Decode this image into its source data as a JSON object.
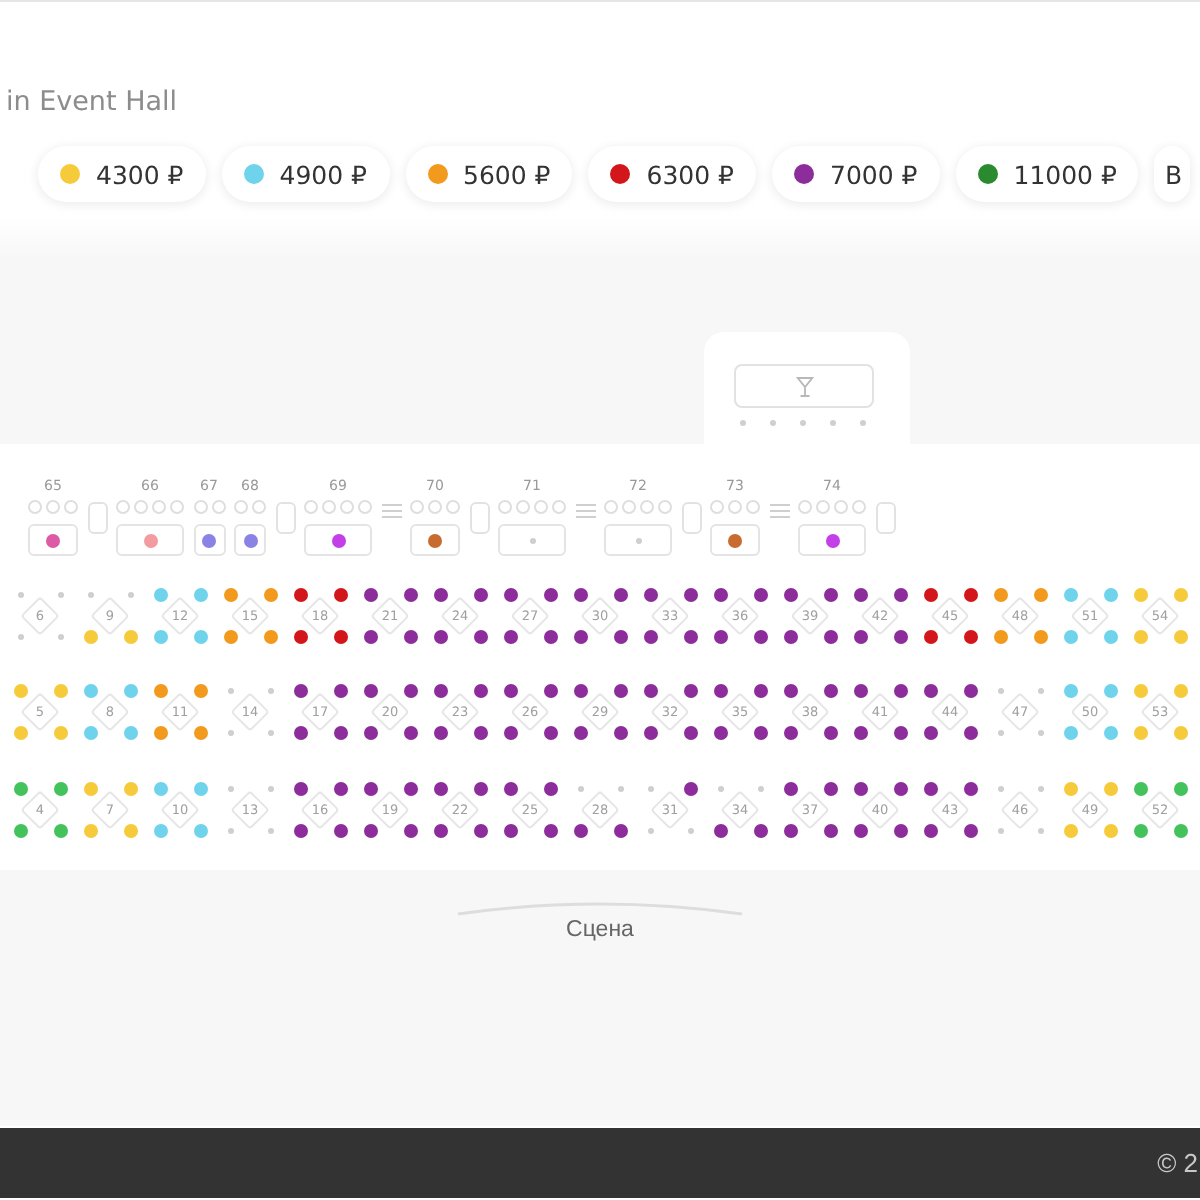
{
  "venue_title": "in Event Hall",
  "price_filters": [
    {
      "kind": "price",
      "label": "4300 ₽",
      "color": "#f6cb3b"
    },
    {
      "kind": "price",
      "label": "4900 ₽",
      "color": "#6fd3ec"
    },
    {
      "kind": "price",
      "label": "5600 ₽",
      "color": "#f29a1e"
    },
    {
      "kind": "price",
      "label": "6300 ₽",
      "color": "#d2161c"
    },
    {
      "kind": "price",
      "label": "7000 ₽",
      "color": "#8d2d9b"
    },
    {
      "kind": "price",
      "label": "11000 ₽",
      "color": "#2a8a30"
    },
    {
      "kind": "plain",
      "label": "В"
    }
  ],
  "bar": {
    "seats": [
      {
        "available": false
      },
      {
        "available": false
      },
      {
        "available": false
      },
      {
        "available": false
      },
      {
        "available": false
      }
    ]
  },
  "loges": [
    {
      "kind": "loge",
      "number": "65",
      "chairs": [
        {
          "available": false
        },
        {
          "available": false
        },
        {
          "available": false
        }
      ],
      "table": {
        "available": true,
        "color": "#dc5aa6"
      }
    },
    {
      "kind": "pillar"
    },
    {
      "kind": "loge",
      "number": "66",
      "chairs": [
        {
          "available": false
        },
        {
          "available": false
        },
        {
          "available": false
        },
        {
          "available": false
        }
      ],
      "table": {
        "available": true,
        "color": "#f29ba0"
      }
    },
    {
      "kind": "loge",
      "number": "67",
      "chairs": [
        {
          "available": false
        },
        {
          "available": false
        }
      ],
      "table": {
        "available": true,
        "color": "#8b82e6"
      }
    },
    {
      "kind": "loge",
      "number": "68",
      "chairs": [
        {
          "available": false
        },
        {
          "available": false
        }
      ],
      "table": {
        "available": true,
        "color": "#8b82e6"
      }
    },
    {
      "kind": "pillar"
    },
    {
      "kind": "loge",
      "number": "69",
      "chairs": [
        {
          "available": false
        },
        {
          "available": false
        },
        {
          "available": false
        },
        {
          "available": false
        }
      ],
      "table": {
        "available": true,
        "color": "#c340e8"
      }
    },
    {
      "kind": "stripes"
    },
    {
      "kind": "loge",
      "number": "70",
      "chairs": [
        {
          "available": false
        },
        {
          "available": false
        },
        {
          "available": false
        }
      ],
      "table": {
        "available": true,
        "color": "#c76b2f"
      }
    },
    {
      "kind": "pillar"
    },
    {
      "kind": "loge",
      "number": "71",
      "chairs": [
        {
          "available": false
        },
        {
          "available": false
        },
        {
          "available": false
        },
        {
          "available": false
        }
      ],
      "table": {
        "available": false
      }
    },
    {
      "kind": "stripes"
    },
    {
      "kind": "loge",
      "number": "72",
      "chairs": [
        {
          "available": false
        },
        {
          "available": false
        },
        {
          "available": false
        },
        {
          "available": false
        }
      ],
      "table": {
        "available": false
      }
    },
    {
      "kind": "pillar"
    },
    {
      "kind": "loge",
      "number": "73",
      "chairs": [
        {
          "available": false
        },
        {
          "available": false
        },
        {
          "available": false
        }
      ],
      "table": {
        "available": true,
        "color": "#c76b2f"
      }
    },
    {
      "kind": "stripes"
    },
    {
      "kind": "loge",
      "number": "74",
      "chairs": [
        {
          "available": false
        },
        {
          "available": false
        },
        {
          "available": false
        },
        {
          "available": false
        }
      ],
      "table": {
        "available": true,
        "color": "#c340e8"
      }
    },
    {
      "kind": "pillar"
    }
  ],
  "rows": [
    {
      "tables": [
        {
          "number": "6",
          "seats": [
            {
              "available": false
            },
            {
              "available": false
            },
            {
              "available": false
            },
            {
              "available": false
            }
          ]
        },
        {
          "number": "9",
          "seats": [
            {
              "available": false
            },
            {
              "available": false
            },
            {
              "available": true,
              "color": "#f6cb3b"
            },
            {
              "available": true,
              "color": "#f6cb3b"
            }
          ]
        },
        {
          "number": "12",
          "seats": [
            {
              "available": true,
              "color": "#6fd3ec"
            },
            {
              "available": true,
              "color": "#6fd3ec"
            },
            {
              "available": true,
              "color": "#6fd3ec"
            },
            {
              "available": true,
              "color": "#6fd3ec"
            }
          ]
        },
        {
          "number": "15",
          "seats": [
            {
              "available": true,
              "color": "#f29a1e"
            },
            {
              "available": true,
              "color": "#f29a1e"
            },
            {
              "available": true,
              "color": "#f29a1e"
            },
            {
              "available": true,
              "color": "#f29a1e"
            }
          ]
        },
        {
          "number": "18",
          "seats": [
            {
              "available": true,
              "color": "#d2161c"
            },
            {
              "available": true,
              "color": "#d2161c"
            },
            {
              "available": true,
              "color": "#d2161c"
            },
            {
              "available": true,
              "color": "#d2161c"
            }
          ]
        },
        {
          "number": "21",
          "seats": [
            {
              "available": true,
              "color": "#8d2d9b"
            },
            {
              "available": true,
              "color": "#8d2d9b"
            },
            {
              "available": true,
              "color": "#8d2d9b"
            },
            {
              "available": true,
              "color": "#8d2d9b"
            }
          ]
        },
        {
          "number": "24",
          "seats": [
            {
              "available": true,
              "color": "#8d2d9b"
            },
            {
              "available": true,
              "color": "#8d2d9b"
            },
            {
              "available": true,
              "color": "#8d2d9b"
            },
            {
              "available": true,
              "color": "#8d2d9b"
            }
          ]
        },
        {
          "number": "27",
          "seats": [
            {
              "available": true,
              "color": "#8d2d9b"
            },
            {
              "available": true,
              "color": "#8d2d9b"
            },
            {
              "available": true,
              "color": "#8d2d9b"
            },
            {
              "available": true,
              "color": "#8d2d9b"
            }
          ]
        },
        {
          "number": "30",
          "seats": [
            {
              "available": true,
              "color": "#8d2d9b"
            },
            {
              "available": true,
              "color": "#8d2d9b"
            },
            {
              "available": true,
              "color": "#8d2d9b"
            },
            {
              "available": true,
              "color": "#8d2d9b"
            }
          ]
        },
        {
          "number": "33",
          "seats": [
            {
              "available": true,
              "color": "#8d2d9b"
            },
            {
              "available": true,
              "color": "#8d2d9b"
            },
            {
              "available": true,
              "color": "#8d2d9b"
            },
            {
              "available": true,
              "color": "#8d2d9b"
            }
          ]
        },
        {
          "number": "36",
          "seats": [
            {
              "available": true,
              "color": "#8d2d9b"
            },
            {
              "available": true,
              "color": "#8d2d9b"
            },
            {
              "available": true,
              "color": "#8d2d9b"
            },
            {
              "available": true,
              "color": "#8d2d9b"
            }
          ]
        },
        {
          "number": "39",
          "seats": [
            {
              "available": true,
              "color": "#8d2d9b"
            },
            {
              "available": true,
              "color": "#8d2d9b"
            },
            {
              "available": true,
              "color": "#8d2d9b"
            },
            {
              "available": true,
              "color": "#8d2d9b"
            }
          ]
        },
        {
          "number": "42",
          "seats": [
            {
              "available": true,
              "color": "#8d2d9b"
            },
            {
              "available": true,
              "color": "#8d2d9b"
            },
            {
              "available": true,
              "color": "#8d2d9b"
            },
            {
              "available": true,
              "color": "#8d2d9b"
            }
          ]
        },
        {
          "number": "45",
          "seats": [
            {
              "available": true,
              "color": "#d2161c"
            },
            {
              "available": true,
              "color": "#d2161c"
            },
            {
              "available": true,
              "color": "#d2161c"
            },
            {
              "available": true,
              "color": "#d2161c"
            }
          ]
        },
        {
          "number": "48",
          "seats": [
            {
              "available": true,
              "color": "#f29a1e"
            },
            {
              "available": true,
              "color": "#f29a1e"
            },
            {
              "available": true,
              "color": "#f29a1e"
            },
            {
              "available": true,
              "color": "#f29a1e"
            }
          ]
        },
        {
          "number": "51",
          "seats": [
            {
              "available": true,
              "color": "#6fd3ec"
            },
            {
              "available": true,
              "color": "#6fd3ec"
            },
            {
              "available": true,
              "color": "#6fd3ec"
            },
            {
              "available": true,
              "color": "#6fd3ec"
            }
          ]
        },
        {
          "number": "54",
          "seats": [
            {
              "available": true,
              "color": "#f6cb3b"
            },
            {
              "available": true,
              "color": "#f6cb3b"
            },
            {
              "available": true,
              "color": "#f6cb3b"
            },
            {
              "available": true,
              "color": "#f6cb3b"
            }
          ]
        }
      ]
    },
    {
      "tables": [
        {
          "number": "5",
          "seats": [
            {
              "available": true,
              "color": "#f6cb3b"
            },
            {
              "available": true,
              "color": "#f6cb3b"
            },
            {
              "available": true,
              "color": "#f6cb3b"
            },
            {
              "available": true,
              "color": "#f6cb3b"
            }
          ]
        },
        {
          "number": "8",
          "seats": [
            {
              "available": true,
              "color": "#6fd3ec"
            },
            {
              "available": true,
              "color": "#6fd3ec"
            },
            {
              "available": true,
              "color": "#6fd3ec"
            },
            {
              "available": true,
              "color": "#6fd3ec"
            }
          ]
        },
        {
          "number": "11",
          "seats": [
            {
              "available": true,
              "color": "#f29a1e"
            },
            {
              "available": true,
              "color": "#f29a1e"
            },
            {
              "available": true,
              "color": "#f29a1e"
            },
            {
              "available": true,
              "color": "#f29a1e"
            }
          ]
        },
        {
          "number": "14",
          "seats": [
            {
              "available": false
            },
            {
              "available": false
            },
            {
              "available": false
            },
            {
              "available": false
            }
          ]
        },
        {
          "number": "17",
          "seats": [
            {
              "available": true,
              "color": "#8d2d9b"
            },
            {
              "available": true,
              "color": "#8d2d9b"
            },
            {
              "available": true,
              "color": "#8d2d9b"
            },
            {
              "available": true,
              "color": "#8d2d9b"
            }
          ]
        },
        {
          "number": "20",
          "seats": [
            {
              "available": true,
              "color": "#8d2d9b"
            },
            {
              "available": true,
              "color": "#8d2d9b"
            },
            {
              "available": true,
              "color": "#8d2d9b"
            },
            {
              "available": true,
              "color": "#8d2d9b"
            }
          ]
        },
        {
          "number": "23",
          "seats": [
            {
              "available": true,
              "color": "#8d2d9b"
            },
            {
              "available": true,
              "color": "#8d2d9b"
            },
            {
              "available": true,
              "color": "#8d2d9b"
            },
            {
              "available": true,
              "color": "#8d2d9b"
            }
          ]
        },
        {
          "number": "26",
          "seats": [
            {
              "available": true,
              "color": "#8d2d9b"
            },
            {
              "available": true,
              "color": "#8d2d9b"
            },
            {
              "available": true,
              "color": "#8d2d9b"
            },
            {
              "available": true,
              "color": "#8d2d9b"
            }
          ]
        },
        {
          "number": "29",
          "seats": [
            {
              "available": true,
              "color": "#8d2d9b"
            },
            {
              "available": true,
              "color": "#8d2d9b"
            },
            {
              "available": true,
              "color": "#8d2d9b"
            },
            {
              "available": true,
              "color": "#8d2d9b"
            }
          ]
        },
        {
          "number": "32",
          "seats": [
            {
              "available": true,
              "color": "#8d2d9b"
            },
            {
              "available": true,
              "color": "#8d2d9b"
            },
            {
              "available": true,
              "color": "#8d2d9b"
            },
            {
              "available": true,
              "color": "#8d2d9b"
            }
          ]
        },
        {
          "number": "35",
          "seats": [
            {
              "available": true,
              "color": "#8d2d9b"
            },
            {
              "available": true,
              "color": "#8d2d9b"
            },
            {
              "available": true,
              "color": "#8d2d9b"
            },
            {
              "available": true,
              "color": "#8d2d9b"
            }
          ]
        },
        {
          "number": "38",
          "seats": [
            {
              "available": true,
              "color": "#8d2d9b"
            },
            {
              "available": true,
              "color": "#8d2d9b"
            },
            {
              "available": true,
              "color": "#8d2d9b"
            },
            {
              "available": true,
              "color": "#8d2d9b"
            }
          ]
        },
        {
          "number": "41",
          "seats": [
            {
              "available": true,
              "color": "#8d2d9b"
            },
            {
              "available": true,
              "color": "#8d2d9b"
            },
            {
              "available": true,
              "color": "#8d2d9b"
            },
            {
              "available": true,
              "color": "#8d2d9b"
            }
          ]
        },
        {
          "number": "44",
          "seats": [
            {
              "available": true,
              "color": "#8d2d9b"
            },
            {
              "available": true,
              "color": "#8d2d9b"
            },
            {
              "available": true,
              "color": "#8d2d9b"
            },
            {
              "available": true,
              "color": "#8d2d9b"
            }
          ]
        },
        {
          "number": "47",
          "seats": [
            {
              "available": false
            },
            {
              "available": false
            },
            {
              "available": false
            },
            {
              "available": false
            }
          ]
        },
        {
          "number": "50",
          "seats": [
            {
              "available": true,
              "color": "#6fd3ec"
            },
            {
              "available": true,
              "color": "#6fd3ec"
            },
            {
              "available": true,
              "color": "#6fd3ec"
            },
            {
              "available": true,
              "color": "#6fd3ec"
            }
          ]
        },
        {
          "number": "53",
          "seats": [
            {
              "available": true,
              "color": "#f6cb3b"
            },
            {
              "available": true,
              "color": "#f6cb3b"
            },
            {
              "available": true,
              "color": "#f6cb3b"
            },
            {
              "available": true,
              "color": "#f6cb3b"
            }
          ]
        }
      ]
    },
    {
      "tables": [
        {
          "number": "4",
          "seats": [
            {
              "available": true,
              "color": "#44c25b"
            },
            {
              "available": true,
              "color": "#44c25b"
            },
            {
              "available": true,
              "color": "#44c25b"
            },
            {
              "available": true,
              "color": "#44c25b"
            }
          ]
        },
        {
          "number": "7",
          "seats": [
            {
              "available": true,
              "color": "#f6cb3b"
            },
            {
              "available": true,
              "color": "#f6cb3b"
            },
            {
              "available": true,
              "color": "#f6cb3b"
            },
            {
              "available": true,
              "color": "#f6cb3b"
            }
          ]
        },
        {
          "number": "10",
          "seats": [
            {
              "available": true,
              "color": "#6fd3ec"
            },
            {
              "available": true,
              "color": "#6fd3ec"
            },
            {
              "available": true,
              "color": "#6fd3ec"
            },
            {
              "available": true,
              "color": "#6fd3ec"
            }
          ]
        },
        {
          "number": "13",
          "seats": [
            {
              "available": false
            },
            {
              "available": false
            },
            {
              "available": false
            },
            {
              "available": false
            }
          ]
        },
        {
          "number": "16",
          "seats": [
            {
              "available": true,
              "color": "#8d2d9b"
            },
            {
              "available": true,
              "color": "#8d2d9b"
            },
            {
              "available": true,
              "color": "#8d2d9b"
            },
            {
              "available": true,
              "color": "#8d2d9b"
            }
          ]
        },
        {
          "number": "19",
          "seats": [
            {
              "available": true,
              "color": "#8d2d9b"
            },
            {
              "available": true,
              "color": "#8d2d9b"
            },
            {
              "available": true,
              "color": "#8d2d9b"
            },
            {
              "available": true,
              "color": "#8d2d9b"
            }
          ]
        },
        {
          "number": "22",
          "seats": [
            {
              "available": true,
              "color": "#8d2d9b"
            },
            {
              "available": true,
              "color": "#8d2d9b"
            },
            {
              "available": true,
              "color": "#8d2d9b"
            },
            {
              "available": true,
              "color": "#8d2d9b"
            }
          ]
        },
        {
          "number": "25",
          "seats": [
            {
              "available": true,
              "color": "#8d2d9b"
            },
            {
              "available": true,
              "color": "#8d2d9b"
            },
            {
              "available": true,
              "color": "#8d2d9b"
            },
            {
              "available": true,
              "color": "#8d2d9b"
            }
          ]
        },
        {
          "number": "28",
          "seats": [
            {
              "available": false
            },
            {
              "available": false
            },
            {
              "available": true,
              "color": "#8d2d9b"
            },
            {
              "available": true,
              "color": "#8d2d9b"
            }
          ]
        },
        {
          "number": "31",
          "seats": [
            {
              "available": false
            },
            {
              "available": true,
              "color": "#8d2d9b"
            },
            {
              "available": false
            },
            {
              "available": false
            }
          ]
        },
        {
          "number": "34",
          "seats": [
            {
              "available": false
            },
            {
              "available": false
            },
            {
              "available": true,
              "color": "#8d2d9b"
            },
            {
              "available": true,
              "color": "#8d2d9b"
            }
          ]
        },
        {
          "number": "37",
          "seats": [
            {
              "available": true,
              "color": "#8d2d9b"
            },
            {
              "available": true,
              "color": "#8d2d9b"
            },
            {
              "available": true,
              "color": "#8d2d9b"
            },
            {
              "available": true,
              "color": "#8d2d9b"
            }
          ]
        },
        {
          "number": "40",
          "seats": [
            {
              "available": true,
              "color": "#8d2d9b"
            },
            {
              "available": true,
              "color": "#8d2d9b"
            },
            {
              "available": true,
              "color": "#8d2d9b"
            },
            {
              "available": true,
              "color": "#8d2d9b"
            }
          ]
        },
        {
          "number": "43",
          "seats": [
            {
              "available": true,
              "color": "#8d2d9b"
            },
            {
              "available": true,
              "color": "#8d2d9b"
            },
            {
              "available": true,
              "color": "#8d2d9b"
            },
            {
              "available": true,
              "color": "#8d2d9b"
            }
          ]
        },
        {
          "number": "46",
          "seats": [
            {
              "available": false
            },
            {
              "available": false
            },
            {
              "available": false
            },
            {
              "available": false
            }
          ]
        },
        {
          "number": "49",
          "seats": [
            {
              "available": true,
              "color": "#f6cb3b"
            },
            {
              "available": true,
              "color": "#f6cb3b"
            },
            {
              "available": true,
              "color": "#f6cb3b"
            },
            {
              "available": true,
              "color": "#f6cb3b"
            }
          ]
        },
        {
          "number": "52",
          "seats": [
            {
              "available": true,
              "color": "#44c25b"
            },
            {
              "available": true,
              "color": "#44c25b"
            },
            {
              "available": true,
              "color": "#44c25b"
            },
            {
              "available": true,
              "color": "#44c25b"
            }
          ]
        }
      ]
    }
  ],
  "stage": {
    "label": "Сцена"
  },
  "footer": {
    "copyright": "© 2"
  }
}
